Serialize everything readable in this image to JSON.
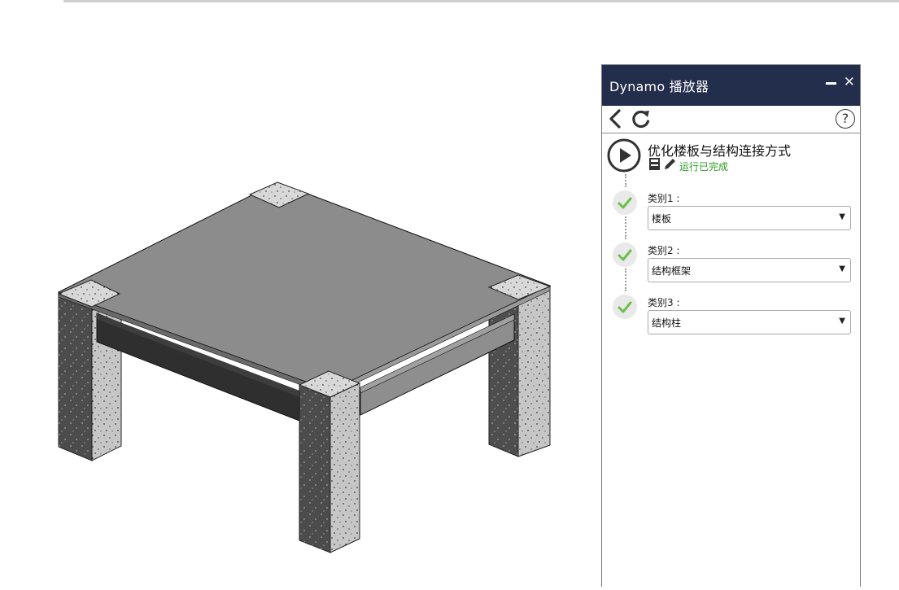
{
  "panel": {
    "title": "Dynamo 播放器",
    "close_glyph": "✕",
    "help_glyph": "?"
  },
  "script": {
    "name": "优化楼板与结构连接方式",
    "status": "运行已完成"
  },
  "inputs": [
    {
      "label": "类别1 :",
      "value": "楼板"
    },
    {
      "label": "类别2 :",
      "value": "结构框架"
    },
    {
      "label": "类别3 :",
      "value": "结构柱"
    }
  ],
  "colors": {
    "titlebar_bg": "#232d4c",
    "status_green": "#2e9b23",
    "check_green": "#6cc04a",
    "slab_top": "#8c8c8c",
    "column_light": "#c4c4c4",
    "column_dark": "#4a4a4a"
  },
  "icons": {
    "back": "chevron-left-icon",
    "refresh": "refresh-icon",
    "help": "help-icon",
    "play": "play-icon",
    "save": "save-icon",
    "edit": "pencil-icon",
    "check": "check-icon"
  }
}
